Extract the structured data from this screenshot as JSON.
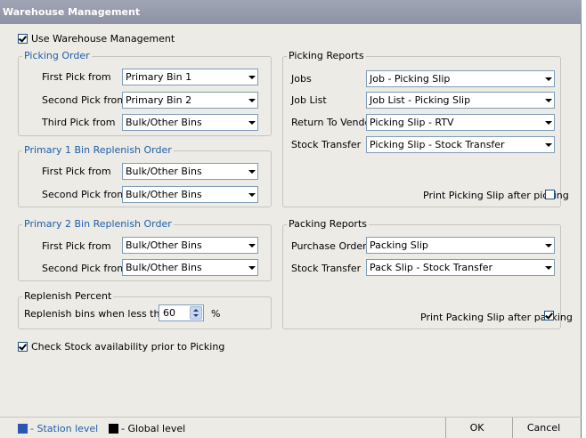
{
  "window": {
    "title": "Warehouse Management"
  },
  "use_wm": {
    "label": "Use Warehouse Management",
    "checked": true
  },
  "picking_order": {
    "title": "Picking Order",
    "rows": [
      {
        "label": "First Pick from",
        "value": "Primary Bin 1"
      },
      {
        "label": "Second Pick from",
        "value": "Primary Bin 2"
      },
      {
        "label": "Third Pick from",
        "value": "Bulk/Other Bins"
      }
    ]
  },
  "primary1": {
    "title": "Primary 1 Bin Replenish Order",
    "rows": [
      {
        "label": "First Pick from",
        "value": "Bulk/Other Bins"
      },
      {
        "label": "Second Pick from",
        "value": "Bulk/Other Bins"
      }
    ]
  },
  "primary2": {
    "title": "Primary 2 Bin Replenish Order",
    "rows": [
      {
        "label": "First Pick from",
        "value": "Bulk/Other Bins"
      },
      {
        "label": "Second Pick from",
        "value": "Bulk/Other Bins"
      }
    ]
  },
  "replenish": {
    "title": "Replenish Percent",
    "label": "Replenish bins when less than",
    "value": "60",
    "unit": "%"
  },
  "check_stock": {
    "label": "Check Stock availability prior to Picking",
    "checked": true
  },
  "picking_reports": {
    "title": "Picking Reports",
    "rows": [
      {
        "label": "Jobs",
        "value": "Job - Picking Slip"
      },
      {
        "label": "Job List",
        "value": "Job List - Picking Slip"
      },
      {
        "label": "Return To Vendor",
        "value": "Picking Slip - RTV"
      },
      {
        "label": "Stock Transfer",
        "value": "Picking Slip - Stock Transfer"
      }
    ],
    "print_label": "Print Picking Slip after picking",
    "print_checked": false
  },
  "packing_reports": {
    "title": "Packing Reports",
    "rows": [
      {
        "label": "Purchase Order",
        "value": "Packing Slip"
      },
      {
        "label": "Stock Transfer",
        "value": "Pack Slip - Stock Transfer"
      }
    ],
    "print_label": "Print Packing Slip after packing",
    "print_checked": true
  },
  "legend": {
    "station_label": "- Station level",
    "station_color": "#2a55b0",
    "global_label": "- Global level",
    "global_color": "#000000"
  },
  "buttons": {
    "ok": "OK",
    "cancel": "Cancel"
  },
  "colors": {
    "title_bar": "#9aa0b0",
    "group_title": "#1f5ea8",
    "panel_bg": "#ecebe6"
  }
}
